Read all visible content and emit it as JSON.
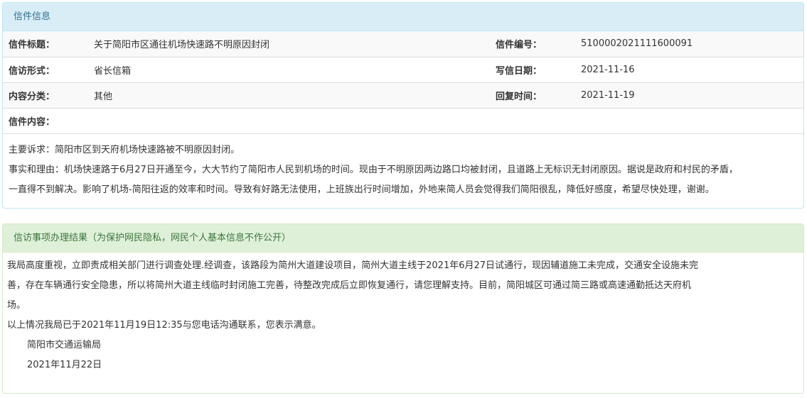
{
  "letter_info": {
    "heading": "信件信息",
    "rows": [
      {
        "label1": "信件标题：",
        "value1": "关于简阳市区通往机场快速路不明原因封闭",
        "label2": "信件编号：",
        "value2": "5100002021111600091"
      },
      {
        "label1": "信访形式：",
        "value1": "省长信箱",
        "label2": "写信日期：",
        "value2": "2021-11-16"
      },
      {
        "label1": "内容分类：",
        "value1": "其他",
        "label2": "回复时间：",
        "value2": "2021-11-19"
      }
    ],
    "content_label": "信件内容：",
    "content_lines": [
      "主要诉求：简阳市区到天府机场快速路被不明原因封闭。",
      "事实和理由：机场快速路于6月27日开通至今，大大节约了简阳市人民到机场的时间。现由于不明原因两边路口均被封闭，且道路上无标识无封闭原因。据说是政府和村民的矛盾，",
      "一直得不到解决。影响了机场-简阳往返的效率和时间。导致有好路无法使用，上班族出行时间增加，外地来简人员会觉得我们简阳很乱，降低好感度，希望尽快处理，谢谢。"
    ]
  },
  "result": {
    "heading": "信访事项办理结果（为保护网民隐私，网民个人基本信息不作公开）",
    "lines": [
      "我局高度重视，立即责成相关部门进行调查处理.经调查，该路段为简州大道建设项目，简州大道主线于2021年6月27日试通行，现因辅道施工未完成，交通安全设施未完",
      "善，存在车辆通行安全隐患，所以将简州大道主线临时封闭施工完善，待整改完成后立即恢复通行，请您理解支持。目前，简阳城区可通过简三路或高速通勤抵达天府机",
      "场。",
      "以上情况我局已于2021年11月19日12:35与您电话沟通联系，您表示满意。"
    ],
    "signature": "简阳市交通运输局",
    "date": "2021年11月22日"
  }
}
